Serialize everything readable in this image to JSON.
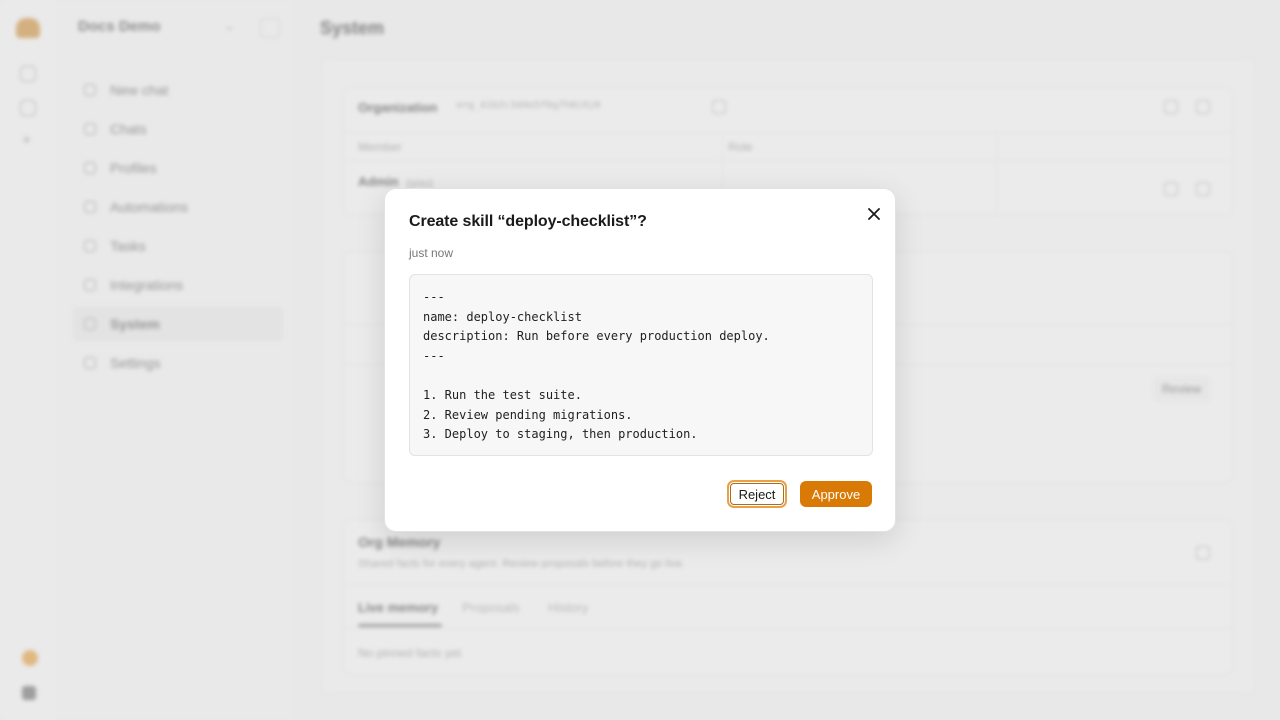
{
  "sidebar": {
    "org_name": "Docs Demo",
    "items": [
      {
        "label": "New chat",
        "icon": "pencil-icon"
      },
      {
        "label": "Chats",
        "icon": "chat-icon"
      },
      {
        "label": "Profiles",
        "icon": "profile-icon"
      },
      {
        "label": "Automations",
        "icon": "automation-icon"
      },
      {
        "label": "Tasks",
        "icon": "tasks-icon"
      },
      {
        "label": "Integrations",
        "icon": "integrations-icon"
      },
      {
        "label": "System",
        "icon": "system-icon",
        "active": true
      },
      {
        "label": "Settings",
        "icon": "settings-icon"
      }
    ]
  },
  "main": {
    "title": "System",
    "org_card": {
      "label": "Organization",
      "org_id": "org_A1b2c3d4e5f6g7h8i9j0",
      "col_member": "Member",
      "col_role": "Role",
      "member_name": "Admin",
      "member_tag": "(you)"
    },
    "skills_card": {
      "review_label": "Review"
    },
    "memory_card": {
      "title": "Org Memory",
      "subtitle": "Shared facts for every agent. Review proposals before they go live.",
      "tabs": [
        "Live memory",
        "Proposals",
        "History"
      ],
      "empty_text": "No pinned facts yet."
    }
  },
  "modal": {
    "title": "Create skill “deploy-checklist”?",
    "time": "just now",
    "code": "---\nname: deploy-checklist\ndescription: Run before every production deploy.\n---\n\n1. Run the test suite.\n2. Review pending migrations.\n3. Deploy to staging, then production.",
    "reject_label": "Reject",
    "approve_label": "Approve"
  },
  "colors": {
    "accent": "#d97a06",
    "focus_ring": "#e8a04a"
  }
}
